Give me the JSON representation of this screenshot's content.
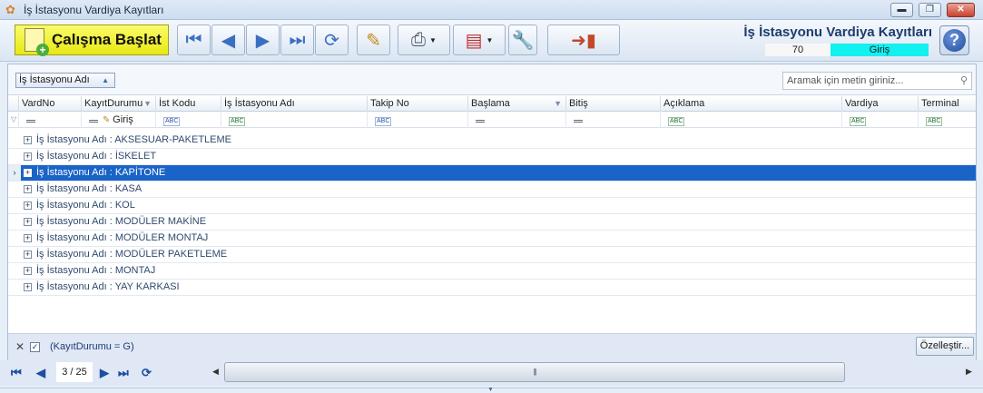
{
  "window": {
    "title": "İş İstasyonu Vardiya Kayıtları",
    "minimize": "▬",
    "maximize": "❐",
    "close": "✕"
  },
  "toolbar": {
    "start_label": "Çalışma Başlat"
  },
  "header": {
    "title": "İş İstasyonu Vardiya Kayıtları",
    "count": "70",
    "status": "Giriş"
  },
  "grid": {
    "group_by": "İş İstasyonu Adı",
    "search_placeholder": "Aramak için metin giriniz...",
    "columns": [
      "VardNo",
      "KayıtDurumu",
      "İst Kodu",
      "İş İstasyonu Adı",
      "Takip No",
      "Başlama",
      "Bitiş",
      "Açıklama",
      "Vardiya",
      "Terminal"
    ],
    "filter_kayit": "Giriş",
    "groups": [
      {
        "label": "İş İstasyonu Adı : AKSESUAR-PAKETLEME",
        "selected": false
      },
      {
        "label": "İş İstasyonu Adı : İSKELET",
        "selected": false
      },
      {
        "label": "İş İstasyonu Adı : KAPİTONE",
        "selected": true
      },
      {
        "label": "İş İstasyonu Adı : KASA",
        "selected": false
      },
      {
        "label": "İş İstasyonu Adı : KOL",
        "selected": false
      },
      {
        "label": "İş İstasyonu Adı : MODÜLER MAKİNE",
        "selected": false
      },
      {
        "label": "İş İstasyonu Adı : MODÜLER MONTAJ",
        "selected": false
      },
      {
        "label": "İş İstasyonu Adı : MODÜLER PAKETLEME",
        "selected": false
      },
      {
        "label": "İş İstasyonu Adı : MONTAJ",
        "selected": false
      },
      {
        "label": "İş İstasyonu Adı : YAY KARKASI",
        "selected": false
      }
    ],
    "filter_expression": "(KayıtDurumu = G)",
    "customize_label": "Özelleştir..."
  },
  "navigator": {
    "page": "3 / 25"
  },
  "colors": {
    "selection": "#1a64c8",
    "start_button": "#f0f020",
    "status_bg": "#12f0f0"
  }
}
